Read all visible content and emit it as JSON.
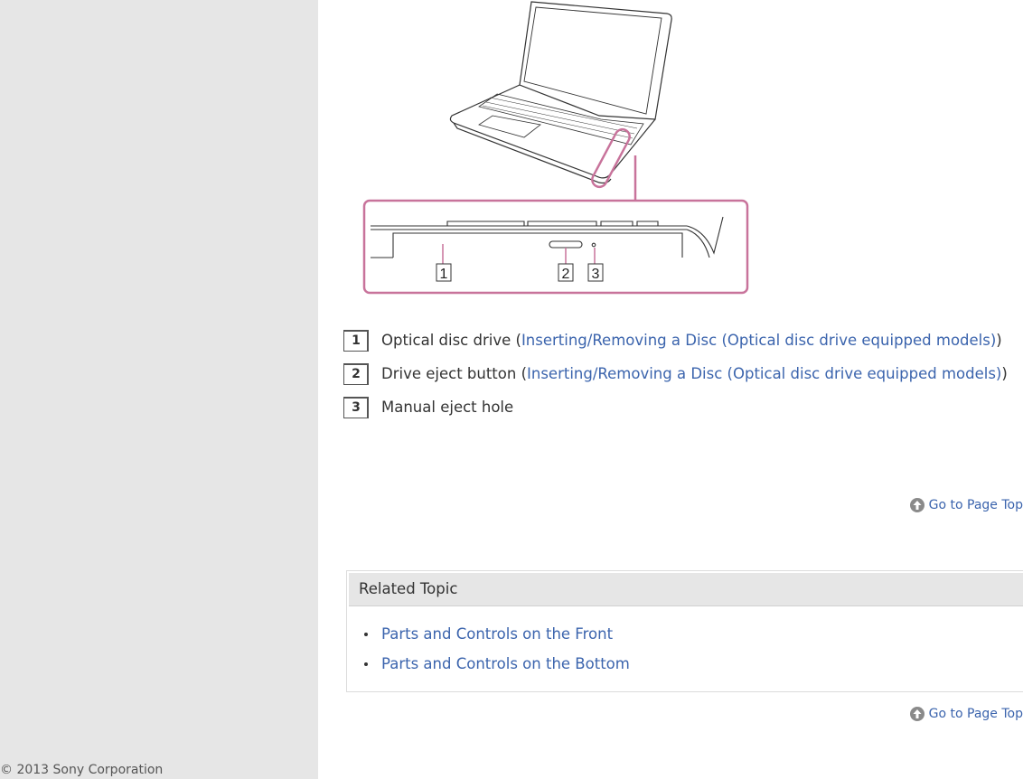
{
  "footer": {
    "copyright": "© 2013 Sony Corporation"
  },
  "figure": {
    "callouts": [
      "1",
      "2",
      "3"
    ],
    "highlight_color": "#c8739b"
  },
  "parts": [
    {
      "num": "1",
      "label": "Optical disc drive (",
      "link": "Inserting/Removing a Disc (Optical disc drive equipped models)",
      "suffix": ")"
    },
    {
      "num": "2",
      "label": "Drive eject button (",
      "link": "Inserting/Removing a Disc (Optical disc drive equipped models)",
      "suffix": ")"
    },
    {
      "num": "3",
      "label": "Manual eject hole",
      "link": null,
      "suffix": ""
    }
  ],
  "page_top": {
    "label": "Go to Page Top",
    "icon": "arrow-up-circle-icon"
  },
  "related": {
    "title": "Related Topic",
    "links": [
      "Parts and Controls on the Front",
      "Parts and Controls on the Bottom"
    ]
  },
  "colors": {
    "link": "#3b64ad",
    "sidebar": "#e6e6e6",
    "callout": "#c8739b"
  }
}
